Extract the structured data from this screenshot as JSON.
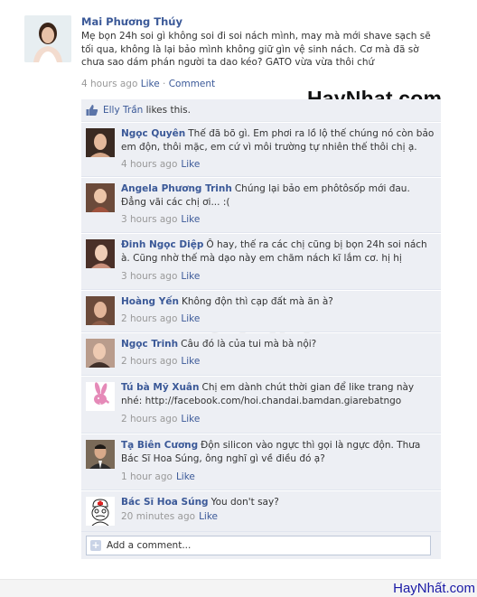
{
  "post": {
    "author": "Mai Phương Thúy",
    "text": "Mẹ bọn 24h soi gì không soi đi soi nách mình, may mà mới shave sạch sẽ tối qua, không là lại bảo mình không giữ gìn vệ sinh nách. Cơ mà đã sờ chưa sao dám phán người ta dao kéo? GATO vừa vừa thôi chứ",
    "time": "4 hours ago",
    "like_label": "Like",
    "separator": "·",
    "comment_label": "Comment"
  },
  "watermark": "HayNhat.com",
  "likes": {
    "who": "Elly Trần",
    "text": "likes this."
  },
  "comments": [
    {
      "name": "Ngọc Quyên",
      "text": "Thế đã bõ gì. Em phơi ra lồ lộ thế chúng nó còn bảo em độn, thôi mặc, em cứ vì môi trường tự nhiên thế thôi chị ạ.",
      "time": "4 hours ago",
      "like": "Like",
      "avatar_color": "#5a3a2a"
    },
    {
      "name": "Angela Phương Trinh",
      "text": "Chúng lại bảo em phôtôsốp mới đau. Đẳng vãi các chị ơi... :(",
      "time": "3 hours ago",
      "like": "Like",
      "avatar_color": "#7a4b3a"
    },
    {
      "name": "Đinh Ngọc Diệp",
      "text": "Ô hay, thế ra các chị cũng bị bọn 24h soi nách à. Cũng nhờ thế mà dạo này em chăm nách kĩ lắm cơ. hị hị",
      "time": "3 hours ago",
      "like": "Like",
      "avatar_color": "#8a5a48"
    },
    {
      "name": "Hoàng Yến",
      "text": "Không độn thì cạp đất mà ăn à?",
      "time": "2 hours ago",
      "like": "Like",
      "avatar_color": "#6b4a3a"
    },
    {
      "name": "Ngọc Trinh",
      "text": "Câu đó là của tui mà bà nội?",
      "time": "2 hours ago",
      "like": "Like",
      "avatar_color": "#4a3028"
    },
    {
      "name": "Tú bà Mỹ Xuân",
      "text": "Chị em dành chút thời gian để like trang này nhé: http://facebook.com/hoi.chandai.bamdan.giarebatngo",
      "time": "2 hours ago",
      "like": "Like",
      "avatar_color": "#e8a8c8"
    },
    {
      "name": "Tạ Biên Cương",
      "text": "Độn silicon vào ngực thì gọi là ngực độn. Thưa Bác Sĩ Hoa Súng, ông nghĩ gì về điều đó ạ?",
      "time": "1 hour ago",
      "like": "Like",
      "avatar_color": "#3a3a30"
    },
    {
      "name": "Bác Sĩ Hoa Súng",
      "text": "You don't say?",
      "time": "20 minutes ago",
      "like": "Like",
      "avatar_color": "#f4f4f4"
    }
  ],
  "add_comment": {
    "placeholder": "Add a comment...",
    "icon": "plus-icon"
  },
  "footer": "HayNhất.com",
  "colors": {
    "link": "#3b5998",
    "panel": "#edeff4",
    "meta": "#999999"
  }
}
